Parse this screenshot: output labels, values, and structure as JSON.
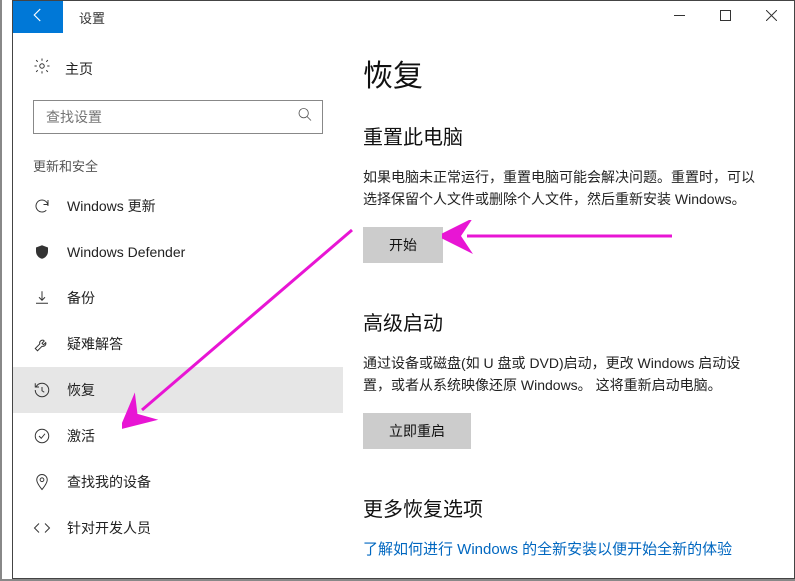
{
  "titlebar": {
    "title": "设置"
  },
  "sidebar": {
    "home_label": "主页",
    "search_placeholder": "查找设置",
    "section_label": "更新和安全",
    "items": [
      {
        "label": "Windows 更新"
      },
      {
        "label": "Windows Defender"
      },
      {
        "label": "备份"
      },
      {
        "label": "疑难解答"
      },
      {
        "label": "恢复"
      },
      {
        "label": "激活"
      },
      {
        "label": "查找我的设备"
      },
      {
        "label": "针对开发人员"
      }
    ]
  },
  "main": {
    "title": "恢复",
    "reset": {
      "heading": "重置此电脑",
      "body": "如果电脑未正常运行，重置电脑可能会解决问题。重置时，可以选择保留个人文件或删除个人文件，然后重新安装 Windows。",
      "button": "开始"
    },
    "advanced": {
      "heading": "高级启动",
      "body": "通过设备或磁盘(如 U 盘或 DVD)启动，更改 Windows 启动设置，或者从系统映像还原 Windows。 这将重新启动电脑。",
      "button": "立即重启"
    },
    "more": {
      "heading": "更多恢复选项",
      "link": "了解如何进行 Windows 的全新安装以便开始全新的体验"
    }
  }
}
